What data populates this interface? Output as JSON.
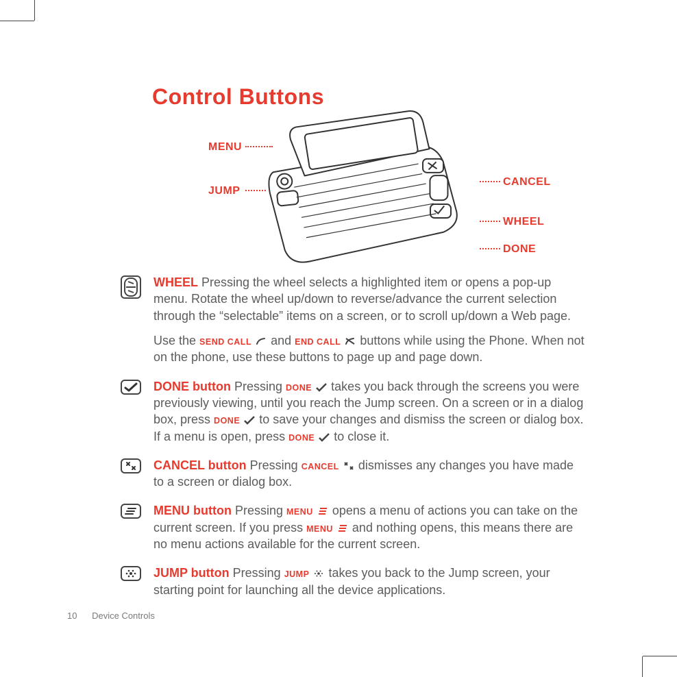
{
  "title": "Control Buttons",
  "diagram": {
    "labels": {
      "menu": "MENU",
      "jump": "JUMP",
      "cancel": "CANCEL",
      "wheel": "WHEEL",
      "done": "DONE"
    }
  },
  "sections": {
    "wheel": {
      "heading": "WHEEL",
      "p1a": " Pressing the wheel selects a highlighted item or opens a pop-up menu. Rotate the wheel up/down to reverse/advance the current selection through the “selectable” items on a screen, or to scroll up/down a Web page.",
      "p2a": "Use the ",
      "send_call": "SEND CALL",
      "p2b": " and ",
      "end_call": "END CALL",
      "p2c": " buttons while using the Phone. When not on the phone, use these buttons to page up and page down."
    },
    "done": {
      "heading": "DONE button",
      "p1a": "  Pressing ",
      "kw": "DONE",
      "p1b": " takes you back through the screens you were previously viewing, until you reach the Jump screen. On a screen or in a dialog box, press ",
      "p1c": " to save your changes and dismiss the screen or dialog box. If a menu is open, press ",
      "p1d": " to close it."
    },
    "cancel": {
      "heading": "CANCEL button",
      "p1a": "  Pressing ",
      "kw": "CANCEL",
      "p1b": " dismisses any changes you have made to a screen or dialog box."
    },
    "menu": {
      "heading": "MENU button",
      "p1a": "  Pressing ",
      "kw": "MENU",
      "p1b": " opens a menu of actions you can take on the current screen. If you press ",
      "p1c": " and nothing opens, this means there are no menu actions available for the current screen."
    },
    "jump": {
      "heading": "JUMP button",
      "p1a": "  Pressing ",
      "kw": "JUMP",
      "p1b": " takes you back to the Jump screen, your starting point for launching all the device applications."
    }
  },
  "footer": {
    "page": "10",
    "section": "Device Controls"
  }
}
